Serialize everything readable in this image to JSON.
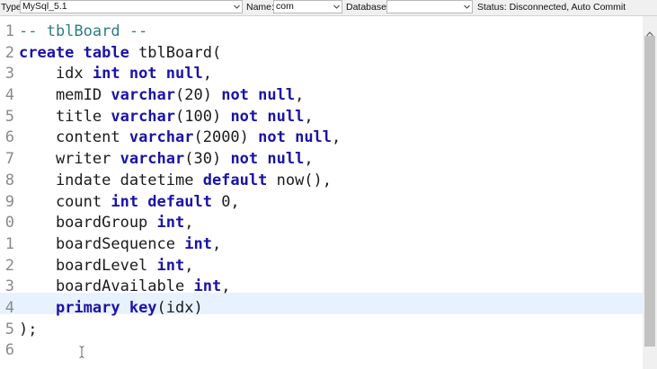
{
  "toolbar": {
    "type_label": "Type:",
    "type_value": "MySql_5.1",
    "name_label": "Name:",
    "name_value": "com",
    "database_label": "Database:",
    "database_value": "",
    "status_text": "Status: Disconnected, Auto Commit"
  },
  "editor": {
    "line_numbers": [
      "1",
      "2",
      "3",
      "4",
      "5",
      "6",
      "7",
      "8",
      "9",
      "0",
      "1",
      "2",
      "3",
      "4",
      "5",
      "6"
    ],
    "current_line_index": 13,
    "lines": [
      [
        {
          "t": "-- tblBoard --",
          "c": "cm"
        }
      ],
      [
        {
          "t": "create table",
          "c": "kw"
        },
        {
          "t": " tblBoard(",
          "c": ""
        }
      ],
      [
        {
          "t": "    idx ",
          "c": ""
        },
        {
          "t": "int not null",
          "c": "kw"
        },
        {
          "t": ",",
          "c": ""
        }
      ],
      [
        {
          "t": "    memID ",
          "c": ""
        },
        {
          "t": "varchar",
          "c": "kw"
        },
        {
          "t": "(20) ",
          "c": ""
        },
        {
          "t": "not null",
          "c": "kw"
        },
        {
          "t": ",",
          "c": ""
        }
      ],
      [
        {
          "t": "    title ",
          "c": ""
        },
        {
          "t": "varchar",
          "c": "kw"
        },
        {
          "t": "(100) ",
          "c": ""
        },
        {
          "t": "not null",
          "c": "kw"
        },
        {
          "t": ",",
          "c": ""
        }
      ],
      [
        {
          "t": "    content ",
          "c": ""
        },
        {
          "t": "varchar",
          "c": "kw"
        },
        {
          "t": "(2000) ",
          "c": ""
        },
        {
          "t": "not null",
          "c": "kw"
        },
        {
          "t": ",",
          "c": ""
        }
      ],
      [
        {
          "t": "    writer ",
          "c": ""
        },
        {
          "t": "varchar",
          "c": "kw"
        },
        {
          "t": "(30) ",
          "c": ""
        },
        {
          "t": "not null",
          "c": "kw"
        },
        {
          "t": ",",
          "c": ""
        }
      ],
      [
        {
          "t": "    indate datetime ",
          "c": ""
        },
        {
          "t": "default",
          "c": "kw"
        },
        {
          "t": " now(),",
          "c": ""
        }
      ],
      [
        {
          "t": "    count ",
          "c": ""
        },
        {
          "t": "int default",
          "c": "kw"
        },
        {
          "t": " 0,",
          "c": ""
        }
      ],
      [
        {
          "t": "    boardGroup ",
          "c": ""
        },
        {
          "t": "int",
          "c": "kw"
        },
        {
          "t": ",",
          "c": ""
        }
      ],
      [
        {
          "t": "    boardSequence ",
          "c": ""
        },
        {
          "t": "int",
          "c": "kw"
        },
        {
          "t": ",",
          "c": ""
        }
      ],
      [
        {
          "t": "    boardLevel ",
          "c": ""
        },
        {
          "t": "int",
          "c": "kw"
        },
        {
          "t": ",",
          "c": ""
        }
      ],
      [
        {
          "t": "    boardAvailable ",
          "c": ""
        },
        {
          "t": "int",
          "c": "kw"
        },
        {
          "t": ",",
          "c": ""
        }
      ],
      [
        {
          "t": "    ",
          "c": ""
        },
        {
          "t": "primary key",
          "c": "kw"
        },
        {
          "t": "(idx)",
          "c": ""
        }
      ],
      [
        {
          "t": ");",
          "c": ""
        }
      ],
      [
        {
          "t": "",
          "c": ""
        }
      ]
    ]
  },
  "colors": {
    "keyword": "#1a13a8",
    "comment": "#2e7d82",
    "current_line_bg": "#e8f2ff"
  },
  "icons": {
    "dropdown": "chevron-down-icon",
    "scroll_up": "arrow-up-icon",
    "cursor": "text-cursor-icon"
  }
}
